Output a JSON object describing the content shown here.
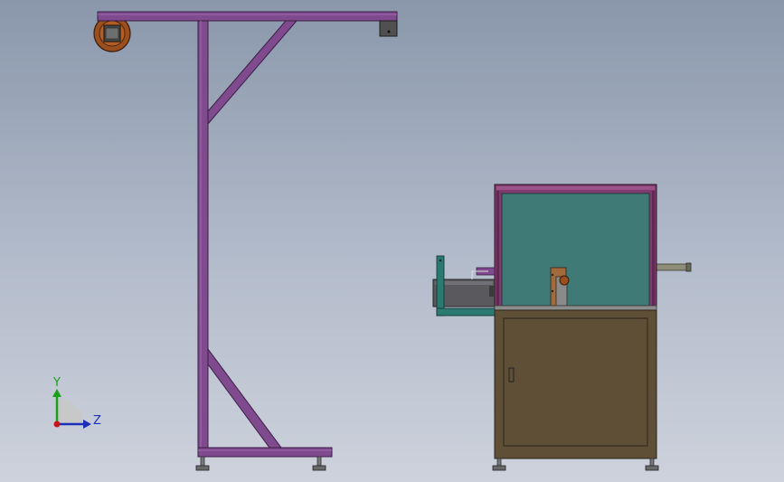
{
  "triad": {
    "y_label": "Y",
    "z_label": "Z",
    "colors": {
      "y_axis": "#1aa01a",
      "z_axis": "#1c2fb8",
      "origin": "#c8141e",
      "plane": "#c8c8c8"
    }
  },
  "colors": {
    "frame": "#7f4a8e",
    "frame_dark": "#4e2a5a",
    "spool": "#9a4f1f",
    "cabinet": "#5e4f36",
    "cabinet_dark": "#3b321f",
    "enclosure_panel": "#3f7a77",
    "enclosure_frame": "#7f3a6e",
    "tray": "#2a7a72",
    "roller": "#8a8a8a"
  }
}
